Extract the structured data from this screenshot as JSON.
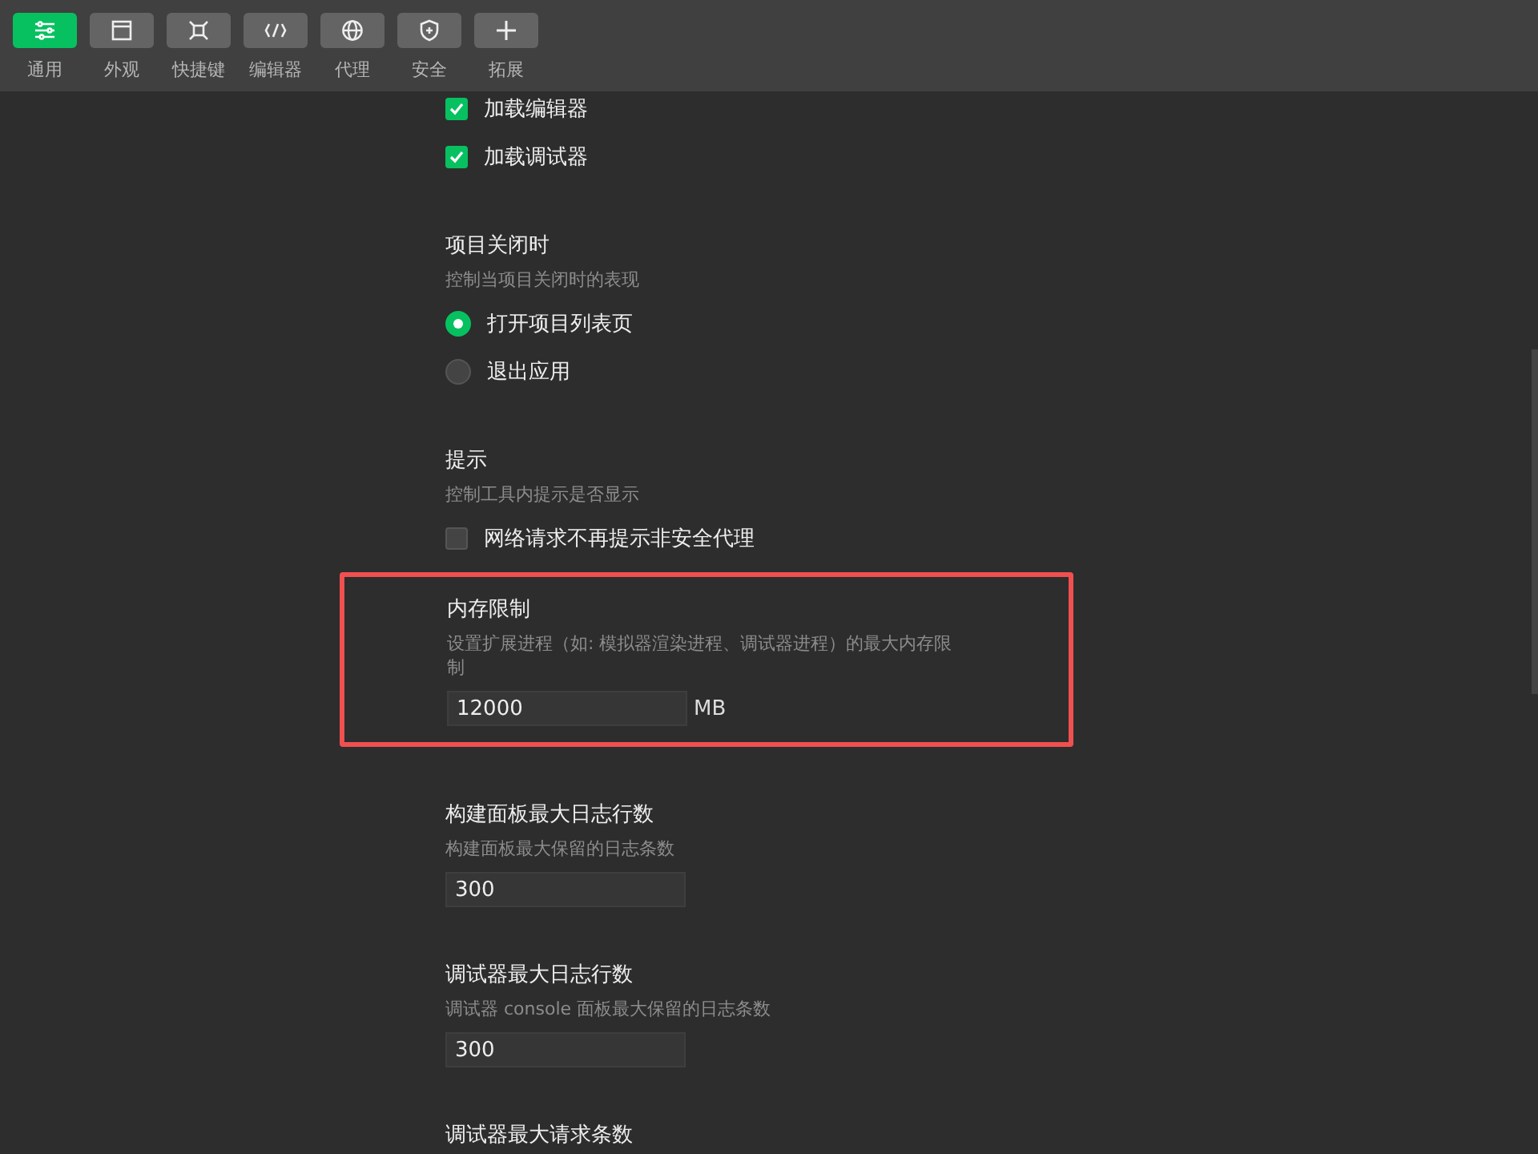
{
  "toolbar": [
    {
      "label": "通用",
      "selected": true
    },
    {
      "label": "外观",
      "selected": false
    },
    {
      "label": "快捷键",
      "selected": false
    },
    {
      "label": "编辑器",
      "selected": false
    },
    {
      "label": "代理",
      "selected": false
    },
    {
      "label": "安全",
      "selected": false
    },
    {
      "label": "拓展",
      "selected": false
    }
  ],
  "sections": [
    {
      "controls": [
        {
          "kind": "checkbox",
          "label": "加载编辑器",
          "checked": true
        },
        {
          "kind": "checkbox",
          "label": "加载调试器",
          "checked": true
        }
      ]
    },
    {
      "title": "项目关闭时",
      "description": "控制当项目关闭时的表现",
      "controls": [
        {
          "kind": "radio",
          "label": "打开项目列表页",
          "selected": true
        },
        {
          "kind": "radio",
          "label": "退出应用",
          "selected": false
        }
      ]
    },
    {
      "title": "提示",
      "description": "控制工具内提示是否显示",
      "controls": [
        {
          "kind": "checkbox",
          "label": "网络请求不再提示非安全代理",
          "checked": false
        }
      ]
    },
    {
      "title": "内存限制",
      "description": "设置扩展进程（如: 模拟器渲染进程、调试器进程）的最大内存限制",
      "highlighted": true,
      "controls": [
        {
          "kind": "number",
          "value": "12000",
          "unit": "MB"
        }
      ]
    },
    {
      "title": "构建面板最大日志行数",
      "description": "构建面板最大保留的日志条数",
      "controls": [
        {
          "kind": "number",
          "value": "300"
        }
      ]
    },
    {
      "title": "调试器最大日志行数",
      "description": "调试器 console 面板最大保留的日志条数",
      "controls": [
        {
          "kind": "number",
          "value": "300"
        }
      ]
    },
    {
      "title": "调试器最大请求条数"
    }
  ]
}
